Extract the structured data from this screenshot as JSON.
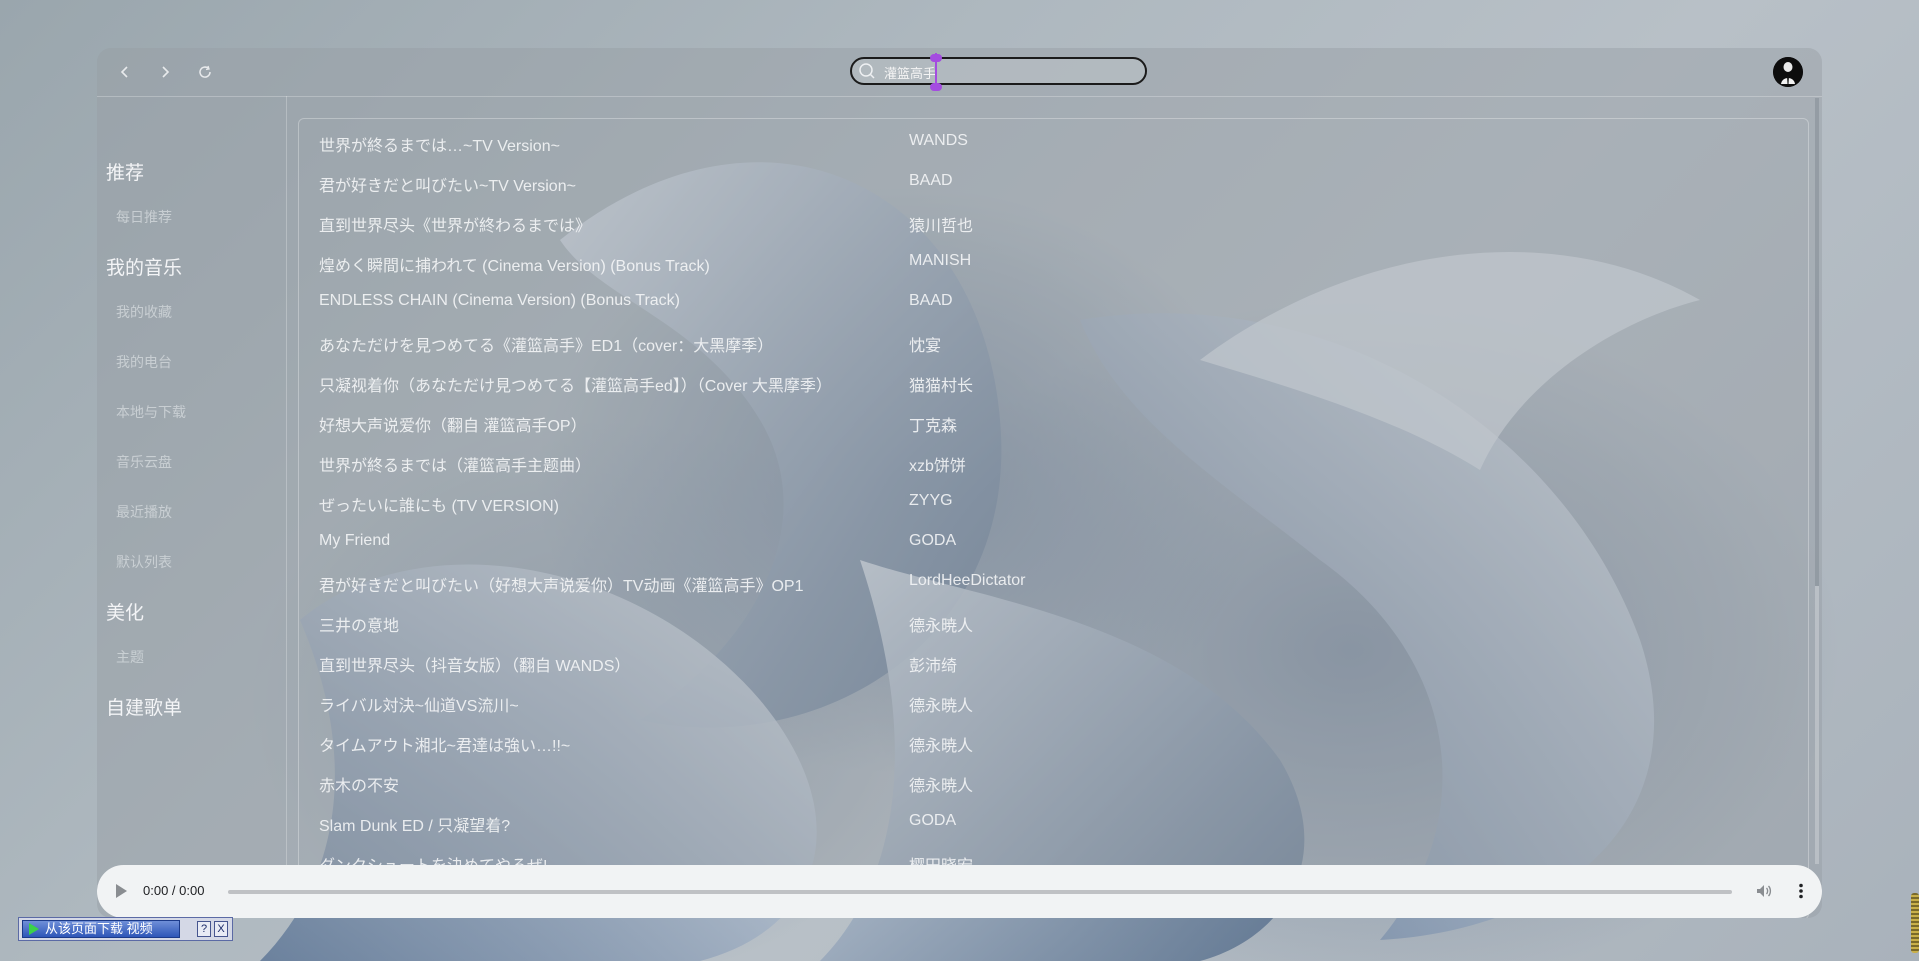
{
  "search": {
    "value": "灌篮高手"
  },
  "sidebar": {
    "sections": [
      {
        "title": "推荐",
        "items": [
          "每日推荐"
        ]
      },
      {
        "title": "我的音乐",
        "items": [
          "我的收藏",
          "我的电台",
          "本地与下载",
          "音乐云盘",
          "最近播放",
          "默认列表"
        ]
      },
      {
        "title": "美化",
        "items": [
          "主题"
        ]
      },
      {
        "title": "自建歌单",
        "items": []
      }
    ]
  },
  "songs": [
    {
      "title": "世界が終るまでは…~TV Version~",
      "artist": "WANDS"
    },
    {
      "title": "君が好きだと叫びたい~TV Version~",
      "artist": "BAAD"
    },
    {
      "title": "直到世界尽头《世界が終わるまでは》",
      "artist": "猿川哲也"
    },
    {
      "title": "煌めく瞬間に捕われて (Cinema Version) (Bonus Track)",
      "artist": "MANISH"
    },
    {
      "title": "ENDLESS CHAIN (Cinema Version) (Bonus Track)",
      "artist": "BAAD"
    },
    {
      "title": "あなただけを見つめてる《灌篮高手》ED1（cover：大黑摩季）",
      "artist": "忱宴"
    },
    {
      "title": "只凝视着你（あなただけ見つめてる【灌篮高手ed】）（Cover 大黑摩季）",
      "artist": "猫猫村长"
    },
    {
      "title": "好想大声说爱你（翻自 灌篮高手OP）",
      "artist": "丁克森"
    },
    {
      "title": "世界が終るまでは（灌篮高手主题曲）",
      "artist": "xzb饼饼"
    },
    {
      "title": "ぜったいに誰にも (TV VERSION)",
      "artist": "ZYYG"
    },
    {
      "title": "My Friend",
      "artist": "GODA"
    },
    {
      "title": "君が好きだと叫びたい（好想大声说爱你）TV动画《灌篮高手》OP1",
      "artist": "LordHeeDictator"
    },
    {
      "title": "三井の意地",
      "artist": "德永暁人"
    },
    {
      "title": "直到世界尽头（抖音女版）（翻自 WANDS）",
      "artist": "彭沛绮"
    },
    {
      "title": "ライバル対決~仙道VS流川~",
      "artist": "德永暁人"
    },
    {
      "title": "タイムアウト湘北~君達は強い…!!~",
      "artist": "德永暁人"
    },
    {
      "title": "赤木の不安",
      "artist": "德永暁人"
    },
    {
      "title": "Slam Dunk ED / 只凝望着?",
      "artist": "GODA"
    },
    {
      "title": "ダンクシュートを決めてやるぜ!",
      "artist": "樱田晓宏"
    }
  ],
  "player": {
    "time": "0:00 / 0:00"
  },
  "download_bar": {
    "label": "从该页面下载 视频",
    "help": "?",
    "close": "X"
  },
  "icons": {
    "back": "chevron-left-icon",
    "forward": "chevron-right-icon",
    "refresh": "refresh-icon",
    "search": "search-icon",
    "play": "play-icon",
    "volume": "volume-icon",
    "more": "more-vertical-icon"
  },
  "colors": {
    "caret": "#a44ce0",
    "player_bg": "#f1f3f4"
  }
}
